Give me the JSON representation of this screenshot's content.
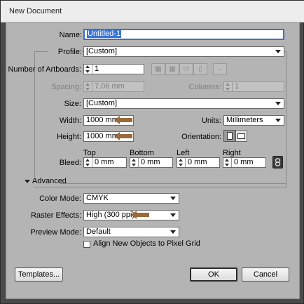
{
  "window": {
    "title": "New Document"
  },
  "name": {
    "label": "Name:",
    "value": "Untitled-1"
  },
  "profile": {
    "label": "Profile:",
    "value": "[Custom]"
  },
  "artboards": {
    "label": "Number of Artboards:",
    "value": "1",
    "arrange_right_arrow": "→"
  },
  "spacing": {
    "label": "Spacing:",
    "value": "7,06 mm"
  },
  "columns": {
    "label": "Columns:",
    "value": "1"
  },
  "size": {
    "label": "Size:",
    "value": "[Custom]"
  },
  "width": {
    "label": "Width:",
    "value": "1000 mm"
  },
  "units": {
    "label": "Units:",
    "value": "Millimeters"
  },
  "height": {
    "label": "Height:",
    "value": "1000 mm"
  },
  "orientation": {
    "label": "Orientation:"
  },
  "bleed": {
    "label": "Bleed:",
    "top": {
      "label": "Top",
      "value": "0 mm"
    },
    "bottom": {
      "label": "Bottom",
      "value": "0 mm"
    },
    "left": {
      "label": "Left",
      "value": "0 mm"
    },
    "right": {
      "label": "Right",
      "value": "0 mm"
    }
  },
  "advanced": {
    "label": "Advanced",
    "color_mode": {
      "label": "Color Mode:",
      "value": "CMYK"
    },
    "raster_effects": {
      "label": "Raster Effects:",
      "value": "High (300 ppi)"
    },
    "preview_mode": {
      "label": "Preview Mode:",
      "value": "Default"
    },
    "align_pixel_grid": {
      "label": "Align New Objects to Pixel Grid",
      "checked": false
    }
  },
  "buttons": {
    "templates": "Templates...",
    "ok": "OK",
    "cancel": "Cancel"
  },
  "colors": {
    "annotation_arrow": "#9a6a3c",
    "focus": "#3b6fd0",
    "selection": "#3874d8"
  }
}
